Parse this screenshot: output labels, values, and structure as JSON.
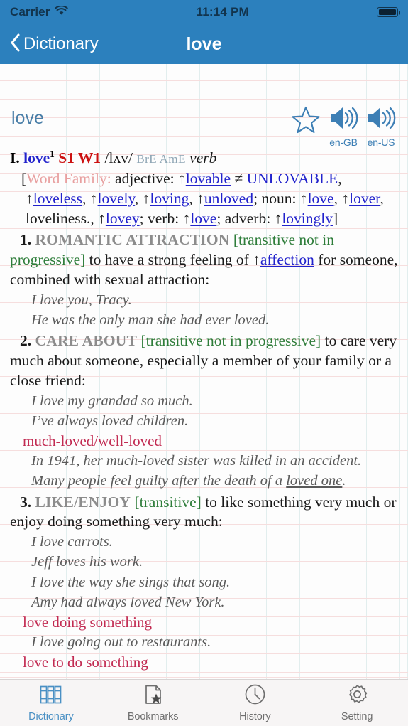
{
  "status_bar": {
    "carrier": "Carrier",
    "time": "11:14 PM",
    "wifi_icon": "wifi-icon",
    "battery_icon": "battery-full-icon"
  },
  "nav": {
    "back_label": "Dictionary",
    "back_icon": "chevron-left-icon",
    "title": "love"
  },
  "colors": {
    "nav_bar": "#2c80bd",
    "headword_blue": "#4a7fa8",
    "link_blue": "#2222cc",
    "frequency_red": "#cc1111",
    "grammar_green": "#2e7d3a",
    "collocation_crimson": "#c22b52",
    "signpost_gray": "#8c8c8c",
    "word_family_pink": "#e8a0a0",
    "example_gray": "#5a5a5a",
    "tab_active": "#4a90c4",
    "tab_inactive": "#6e6e6e"
  },
  "entry_header": {
    "word": "love",
    "star_icon": "star-outline-icon",
    "audio_gb": {
      "icon": "speaker-icon",
      "label": "en-GB"
    },
    "audio_us": {
      "icon": "speaker-icon",
      "label": "en-US"
    }
  },
  "headword_line": {
    "roman_numeral": "I.",
    "word": "love",
    "homograph": "1",
    "frequency": "S1 W1",
    "pronunciation": "/lʌv/",
    "dialects": "BrE AmE",
    "part_of_speech": "verb"
  },
  "word_family": {
    "open_bracket": "[",
    "label": "Word Family:",
    "adjective_label": "adjective:",
    "lovable": "lovable",
    "not_equal": "≠",
    "unlovable": "UNLOVABLE",
    "loveless": "loveless",
    "lovely": "lovely",
    "loving": "loving",
    "unloved": "unloved",
    "noun_label": "noun:",
    "love_noun": "love",
    "lover": "lover",
    "loveliness": "loveliness.,",
    "lovey": "lovey",
    "verb_label": "verb:",
    "love_verb": "love",
    "adverb_label": "adverb:",
    "lovingly": "lovingly",
    "close_bracket": "]"
  },
  "senses": [
    {
      "number": "1.",
      "signpost": "ROMANTIC ATTRACTION",
      "grammar": "[transitive not in progressive]",
      "definition_before_xref": "to have a strong feeling of ↑",
      "xref": "affection",
      "definition_after_xref": " for someone, combined with sexual attraction:",
      "examples": [
        "I love you, Tracy.",
        "He was the only man she had ever loved."
      ]
    },
    {
      "number": "2.",
      "signpost": "CARE ABOUT",
      "grammar": "[transitive not in progressive]",
      "definition": "to care very much about someone, especially a member of your family or a close friend:",
      "examples": [
        "I love my grandad so much.",
        "I’ve always loved children."
      ],
      "collocation": "much-loved/well-loved",
      "collocation_examples": [
        {
          "before": "In 1941, her much-loved sister was killed in an accident.",
          "underline": "",
          "after": ""
        },
        {
          "before": "Many people feel guilty after the death of a ",
          "underline": "loved one",
          "after": "."
        }
      ]
    },
    {
      "number": "3.",
      "signpost": "LIKE/ENJOY",
      "grammar": "[transitive]",
      "definition": "to like something very much or enjoy doing something very much:",
      "examples": [
        "I love carrots.",
        "Jeff loves his work.",
        "I love the way she sings that song.",
        "Amy had always loved New York."
      ],
      "collocation": "love doing something",
      "collocation_examples": [
        {
          "before": "I love going out to restaurants.",
          "underline": "",
          "after": ""
        }
      ],
      "collocation2": "love to do something"
    }
  ],
  "tabs": [
    {
      "label": "Dictionary",
      "icon": "books-icon",
      "active": true
    },
    {
      "label": "Bookmarks",
      "icon": "page-star-icon",
      "active": false
    },
    {
      "label": "History",
      "icon": "clock-icon",
      "active": false
    },
    {
      "label": "Setting",
      "icon": "gear-icon",
      "active": false
    }
  ]
}
